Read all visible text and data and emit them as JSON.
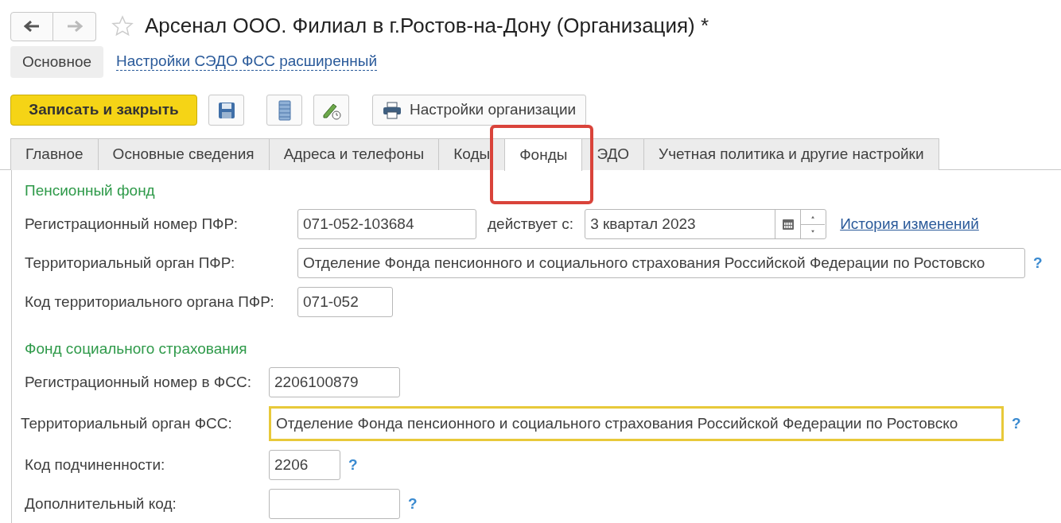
{
  "window": {
    "title": "Арсенал ООО. Филиал в г.Ростов-на-Дону (Организация) *",
    "favorite": false
  },
  "nav": [
    {
      "label": "Основное",
      "selected": true
    },
    {
      "label": "Настройки СЭДО ФСС расширенный",
      "selected": false
    }
  ],
  "toolbar": {
    "primary": "Записать и закрыть",
    "settings": "Настройки организации"
  },
  "tabs": [
    {
      "label": "Главное",
      "selected": false,
      "highlighted": false
    },
    {
      "label": "Основные сведения",
      "selected": false,
      "highlighted": false
    },
    {
      "label": "Адреса и телефоны",
      "selected": false,
      "highlighted": false
    },
    {
      "label": "Коды",
      "selected": false,
      "highlighted": false
    },
    {
      "label": "Фонды",
      "selected": true,
      "highlighted": true
    },
    {
      "label": "ЭДО",
      "selected": false,
      "highlighted": false
    },
    {
      "label": "Учетная политика и другие настройки",
      "selected": false,
      "highlighted": false
    }
  ],
  "sections": [
    {
      "title": "Пенсионный фонд",
      "fields": [
        {
          "label": "Регистрационный номер ПФР:",
          "value": "071-052-103684",
          "focused": false,
          "effective_label": "действует с:",
          "effective_value": "3 квартал 2023",
          "link": "История изменений"
        },
        {
          "label": "Территориальный орган ПФР:",
          "value": "Отделение Фонда пенсионного и социального страхования Российской Федерации по Ростовско",
          "help": "?",
          "focused": false
        },
        {
          "label": "Код территориального органа ПФР:",
          "value": "071-052",
          "focused": false
        }
      ]
    },
    {
      "title": "Фонд социального страхования",
      "fields": [
        {
          "label": "Регистрационный номер в ФСС:",
          "value": "2206100879",
          "focused": false
        },
        {
          "label": "Территориальный орган ФСС:",
          "value": "Отделение Фонда пенсионного и социального страхования Российской Федерации по Ростовско",
          "help": "?",
          "focused": true
        },
        {
          "label": "Код подчиненности:",
          "value": "2206",
          "help": "?",
          "focused": false
        },
        {
          "label": "Дополнительный код:",
          "help": "?",
          "focused": false
        }
      ]
    }
  ]
}
